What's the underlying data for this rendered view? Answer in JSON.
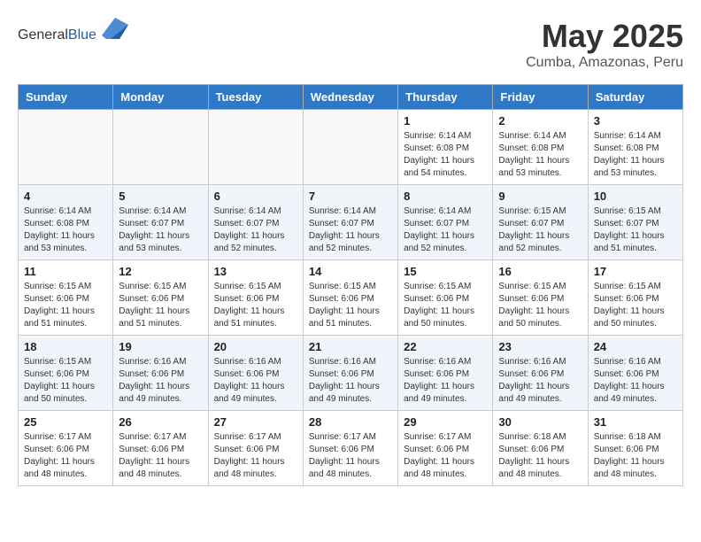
{
  "header": {
    "logo_general": "General",
    "logo_blue": "Blue",
    "month_title": "May 2025",
    "subtitle": "Cumba, Amazonas, Peru"
  },
  "weekdays": [
    "Sunday",
    "Monday",
    "Tuesday",
    "Wednesday",
    "Thursday",
    "Friday",
    "Saturday"
  ],
  "weeks": [
    [
      {
        "day": "",
        "sunrise": "",
        "sunset": "",
        "daylight": ""
      },
      {
        "day": "",
        "sunrise": "",
        "sunset": "",
        "daylight": ""
      },
      {
        "day": "",
        "sunrise": "",
        "sunset": "",
        "daylight": ""
      },
      {
        "day": "",
        "sunrise": "",
        "sunset": "",
        "daylight": ""
      },
      {
        "day": "1",
        "sunrise": "Sunrise: 6:14 AM",
        "sunset": "Sunset: 6:08 PM",
        "daylight": "Daylight: 11 hours and 54 minutes."
      },
      {
        "day": "2",
        "sunrise": "Sunrise: 6:14 AM",
        "sunset": "Sunset: 6:08 PM",
        "daylight": "Daylight: 11 hours and 53 minutes."
      },
      {
        "day": "3",
        "sunrise": "Sunrise: 6:14 AM",
        "sunset": "Sunset: 6:08 PM",
        "daylight": "Daylight: 11 hours and 53 minutes."
      }
    ],
    [
      {
        "day": "4",
        "sunrise": "Sunrise: 6:14 AM",
        "sunset": "Sunset: 6:08 PM",
        "daylight": "Daylight: 11 hours and 53 minutes."
      },
      {
        "day": "5",
        "sunrise": "Sunrise: 6:14 AM",
        "sunset": "Sunset: 6:07 PM",
        "daylight": "Daylight: 11 hours and 53 minutes."
      },
      {
        "day": "6",
        "sunrise": "Sunrise: 6:14 AM",
        "sunset": "Sunset: 6:07 PM",
        "daylight": "Daylight: 11 hours and 52 minutes."
      },
      {
        "day": "7",
        "sunrise": "Sunrise: 6:14 AM",
        "sunset": "Sunset: 6:07 PM",
        "daylight": "Daylight: 11 hours and 52 minutes."
      },
      {
        "day": "8",
        "sunrise": "Sunrise: 6:14 AM",
        "sunset": "Sunset: 6:07 PM",
        "daylight": "Daylight: 11 hours and 52 minutes."
      },
      {
        "day": "9",
        "sunrise": "Sunrise: 6:15 AM",
        "sunset": "Sunset: 6:07 PM",
        "daylight": "Daylight: 11 hours and 52 minutes."
      },
      {
        "day": "10",
        "sunrise": "Sunrise: 6:15 AM",
        "sunset": "Sunset: 6:07 PM",
        "daylight": "Daylight: 11 hours and 51 minutes."
      }
    ],
    [
      {
        "day": "11",
        "sunrise": "Sunrise: 6:15 AM",
        "sunset": "Sunset: 6:06 PM",
        "daylight": "Daylight: 11 hours and 51 minutes."
      },
      {
        "day": "12",
        "sunrise": "Sunrise: 6:15 AM",
        "sunset": "Sunset: 6:06 PM",
        "daylight": "Daylight: 11 hours and 51 minutes."
      },
      {
        "day": "13",
        "sunrise": "Sunrise: 6:15 AM",
        "sunset": "Sunset: 6:06 PM",
        "daylight": "Daylight: 11 hours and 51 minutes."
      },
      {
        "day": "14",
        "sunrise": "Sunrise: 6:15 AM",
        "sunset": "Sunset: 6:06 PM",
        "daylight": "Daylight: 11 hours and 51 minutes."
      },
      {
        "day": "15",
        "sunrise": "Sunrise: 6:15 AM",
        "sunset": "Sunset: 6:06 PM",
        "daylight": "Daylight: 11 hours and 50 minutes."
      },
      {
        "day": "16",
        "sunrise": "Sunrise: 6:15 AM",
        "sunset": "Sunset: 6:06 PM",
        "daylight": "Daylight: 11 hours and 50 minutes."
      },
      {
        "day": "17",
        "sunrise": "Sunrise: 6:15 AM",
        "sunset": "Sunset: 6:06 PM",
        "daylight": "Daylight: 11 hours and 50 minutes."
      }
    ],
    [
      {
        "day": "18",
        "sunrise": "Sunrise: 6:15 AM",
        "sunset": "Sunset: 6:06 PM",
        "daylight": "Daylight: 11 hours and 50 minutes."
      },
      {
        "day": "19",
        "sunrise": "Sunrise: 6:16 AM",
        "sunset": "Sunset: 6:06 PM",
        "daylight": "Daylight: 11 hours and 49 minutes."
      },
      {
        "day": "20",
        "sunrise": "Sunrise: 6:16 AM",
        "sunset": "Sunset: 6:06 PM",
        "daylight": "Daylight: 11 hours and 49 minutes."
      },
      {
        "day": "21",
        "sunrise": "Sunrise: 6:16 AM",
        "sunset": "Sunset: 6:06 PM",
        "daylight": "Daylight: 11 hours and 49 minutes."
      },
      {
        "day": "22",
        "sunrise": "Sunrise: 6:16 AM",
        "sunset": "Sunset: 6:06 PM",
        "daylight": "Daylight: 11 hours and 49 minutes."
      },
      {
        "day": "23",
        "sunrise": "Sunrise: 6:16 AM",
        "sunset": "Sunset: 6:06 PM",
        "daylight": "Daylight: 11 hours and 49 minutes."
      },
      {
        "day": "24",
        "sunrise": "Sunrise: 6:16 AM",
        "sunset": "Sunset: 6:06 PM",
        "daylight": "Daylight: 11 hours and 49 minutes."
      }
    ],
    [
      {
        "day": "25",
        "sunrise": "Sunrise: 6:17 AM",
        "sunset": "Sunset: 6:06 PM",
        "daylight": "Daylight: 11 hours and 48 minutes."
      },
      {
        "day": "26",
        "sunrise": "Sunrise: 6:17 AM",
        "sunset": "Sunset: 6:06 PM",
        "daylight": "Daylight: 11 hours and 48 minutes."
      },
      {
        "day": "27",
        "sunrise": "Sunrise: 6:17 AM",
        "sunset": "Sunset: 6:06 PM",
        "daylight": "Daylight: 11 hours and 48 minutes."
      },
      {
        "day": "28",
        "sunrise": "Sunrise: 6:17 AM",
        "sunset": "Sunset: 6:06 PM",
        "daylight": "Daylight: 11 hours and 48 minutes."
      },
      {
        "day": "29",
        "sunrise": "Sunrise: 6:17 AM",
        "sunset": "Sunset: 6:06 PM",
        "daylight": "Daylight: 11 hours and 48 minutes."
      },
      {
        "day": "30",
        "sunrise": "Sunrise: 6:18 AM",
        "sunset": "Sunset: 6:06 PM",
        "daylight": "Daylight: 11 hours and 48 minutes."
      },
      {
        "day": "31",
        "sunrise": "Sunrise: 6:18 AM",
        "sunset": "Sunset: 6:06 PM",
        "daylight": "Daylight: 11 hours and 48 minutes."
      }
    ]
  ]
}
